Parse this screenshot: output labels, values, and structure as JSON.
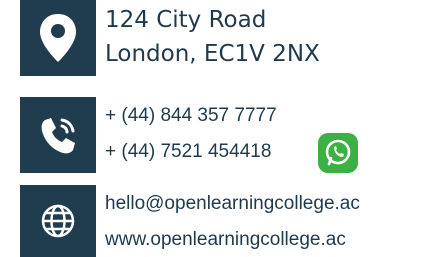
{
  "address": {
    "icon": "location-pin-icon",
    "line1": "124 City Road",
    "line2": "London, EC1V 2NX"
  },
  "phone": {
    "icon": "phone-icon",
    "line1": "+ (44) 844 357 7777",
    "line2": "+ (44) 7521 454418",
    "whatsapp_icon": "whatsapp-icon"
  },
  "web": {
    "icon": "globe-icon",
    "email": "hello@openlearningcollege.ac",
    "website": "www.openlearningcollege.ac"
  },
  "colors": {
    "tile": "#1f3d4f",
    "text": "#1f3a4d",
    "whatsapp": "#3cb043"
  }
}
